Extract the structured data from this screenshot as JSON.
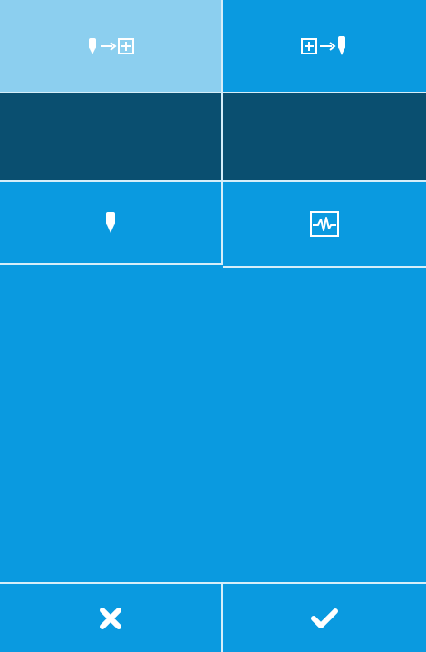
{
  "colors": {
    "background": "#0a9ae0",
    "tab_active": "#8ccfef",
    "panel_dark": "#0a4f70",
    "divider": "#d6eef9",
    "icon": "#ffffff"
  },
  "tabs": [
    {
      "icon": "needle-to-box-icon",
      "active": true
    },
    {
      "icon": "box-to-needle-icon",
      "active": false
    }
  ],
  "tools": [
    {
      "icon": "needle-icon"
    },
    {
      "icon": "waveform-monitor-icon"
    }
  ],
  "actions": [
    {
      "icon": "close-icon"
    },
    {
      "icon": "check-icon"
    }
  ]
}
